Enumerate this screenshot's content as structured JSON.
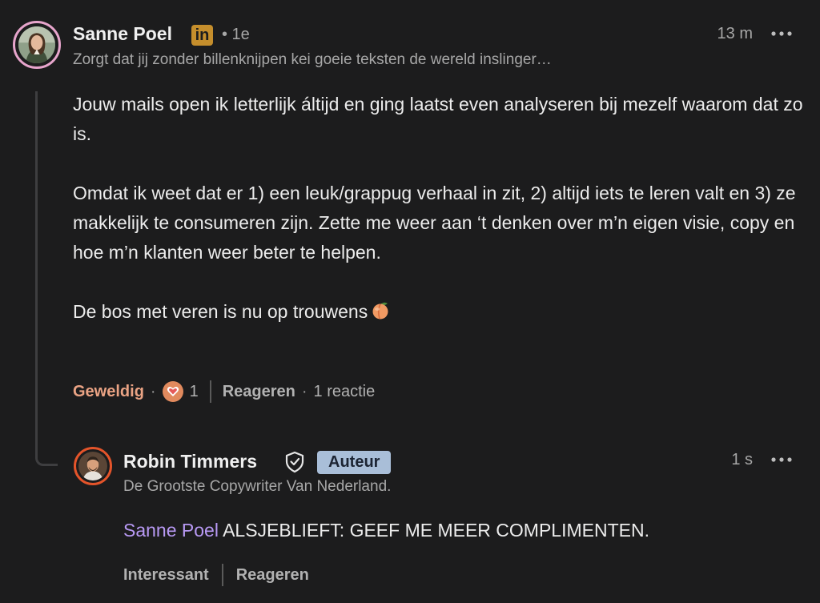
{
  "comment": {
    "author": {
      "name": "Sanne Poel",
      "network_badge": "in",
      "degree": "• 1e",
      "headline": "Zorgt dat jij zonder billenknijpen kei goeie teksten de wereld inslinger…",
      "avatar": "avatar-photo-woman"
    },
    "time": "13 m",
    "more_icon": "more-horizontal-icon",
    "paragraphs": [
      "Jouw mails open ik letterlijk áltijd en ging laatst even analyseren bij mezelf waarom dat zo is.",
      "Omdat ik weet dat er 1) een leuk/grappug verhaal in zit, 2) altijd iets te leren valt en 3) ze makkelijk te consumeren zijn. Zette me weer aan ‘t denken over m’n eigen visie, copy en hoe m’n klanten weer beter te helpen.",
      "De bos met veren is nu op trouwens"
    ],
    "trailing_emoji": "peach-emoji",
    "actions": {
      "reaction_label": "Geweldig",
      "reaction_icon": "heart-reaction-icon",
      "reaction_count": "1",
      "reply_label": "Reageren",
      "replies_count": "1 reactie",
      "dot": "·"
    }
  },
  "reply": {
    "author": {
      "name": "Robin Timmers",
      "verified_icon": "shield-check-icon",
      "role_badge": "Auteur",
      "headline": "De Grootste Copywriter Van Nederland.",
      "avatar": "avatar-photo-man"
    },
    "time": "1 s",
    "more_icon": "more-horizontal-icon",
    "mention": "Sanne Poel",
    "text": "ALSJEBLIEFT: GEEF ME MEER COMPLIMENTEN.",
    "actions": {
      "react_label": "Interessant",
      "reply_label": "Reageren"
    }
  },
  "colors": {
    "background": "#1c1c1d",
    "text": "#ececec",
    "muted": "#a7a7a7",
    "reaction_accent": "#eaa384",
    "mention": "#b899f4",
    "author_badge": "#a9bed8",
    "linkedin_badge": "#c58e2c",
    "thread_line": "#3e3e40"
  }
}
